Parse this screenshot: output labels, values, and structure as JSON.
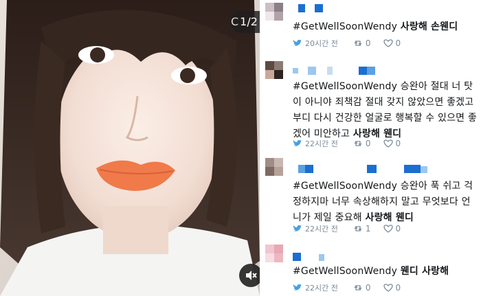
{
  "media": {
    "counter": "1/2",
    "counter_prefix": "C",
    "mute_icon": "speaker-muted-icon"
  },
  "tweets": [
    {
      "hashtag": "#GetWellSoonWendy",
      "message": "",
      "bold_text": "사랑해 손웬디",
      "time": "20시간 전",
      "retweets": "0",
      "likes": "0"
    },
    {
      "hashtag": "#GetWellSoonWendy",
      "message": " 승완아 절대 너 탓이 아니야 죄책감 절대 갖지 않았으면 좋겠고 부디 다시 건강한 얼굴로 행복할 수 있으면 좋겠어 미안하고 ",
      "bold_text": "사랑해 웬디",
      "time": "22시간 전",
      "retweets": "0",
      "likes": "0"
    },
    {
      "hashtag": "#GetWellSoonWendy",
      "message": " 승완아 푹 쉬고 걱정하지마 너무 속상해하지 말고 무엇보다 언니가 제일 중요해 ",
      "bold_text": "사랑해 웬디",
      "time": "22시간 전",
      "retweets": "1",
      "likes": "0"
    },
    {
      "hashtag": "#GetWellSoonWendy",
      "message": " ",
      "bold_text": "웬디 사랑해",
      "time": "22시간 전",
      "retweets": "0",
      "likes": "0"
    }
  ],
  "colors": {
    "censor_blue": "#1a6fd1",
    "censor_light": "#9cc8ef",
    "lip": "#f07a4a",
    "hair": "#3a2a22"
  }
}
